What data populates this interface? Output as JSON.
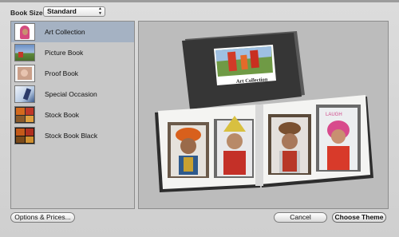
{
  "header": {
    "book_size_label": "Book Size:",
    "book_size_value": "Standard"
  },
  "themes": [
    {
      "label": "Art Collection",
      "selected": true
    },
    {
      "label": "Picture Book",
      "selected": false
    },
    {
      "label": "Proof Book",
      "selected": false
    },
    {
      "label": "Special Occasion",
      "selected": false
    },
    {
      "label": "Stock Book",
      "selected": false
    },
    {
      "label": "Stock Book Black",
      "selected": false
    }
  ],
  "preview": {
    "cover_title": "Art Collection",
    "page_text": "LAUGH",
    "caption": ""
  },
  "buttons": {
    "options": "Options & Prices...",
    "cancel": "Cancel",
    "choose": "Choose Theme"
  },
  "colors": {
    "selection": "#a5b2c3",
    "panel": "#c8c8c8",
    "preview_bg": "#bcbcbc",
    "book_cover": "#3a3a3a"
  }
}
